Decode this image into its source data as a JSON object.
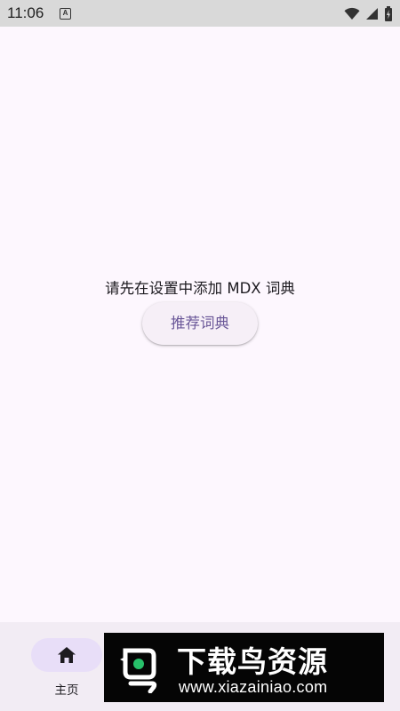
{
  "status_bar": {
    "time": "11:06",
    "notification_icon_letter": "A",
    "icons": [
      "a-notification-icon",
      "wifi-icon",
      "cellular-signal-icon",
      "battery-icon"
    ]
  },
  "main": {
    "empty_message": "请先在设置中添加 MDX 词典",
    "recommend_button_label": "推荐词典"
  },
  "bottom_nav": {
    "items": [
      {
        "label": "主页",
        "icon": "home-icon",
        "selected": true
      }
    ]
  },
  "watermark": {
    "title": "下载鸟资源",
    "url": "www.xiazainiao.com"
  },
  "colors": {
    "background": "#fdf7fe",
    "status_bar": "#d9d9d9",
    "button_text": "#6a5798",
    "button_bg": "#f6eff7",
    "nav_bg": "#f2ecf4",
    "nav_indicator": "#e8def8",
    "watermark_bg": "#050505",
    "watermark_accent": "#27c06a"
  }
}
